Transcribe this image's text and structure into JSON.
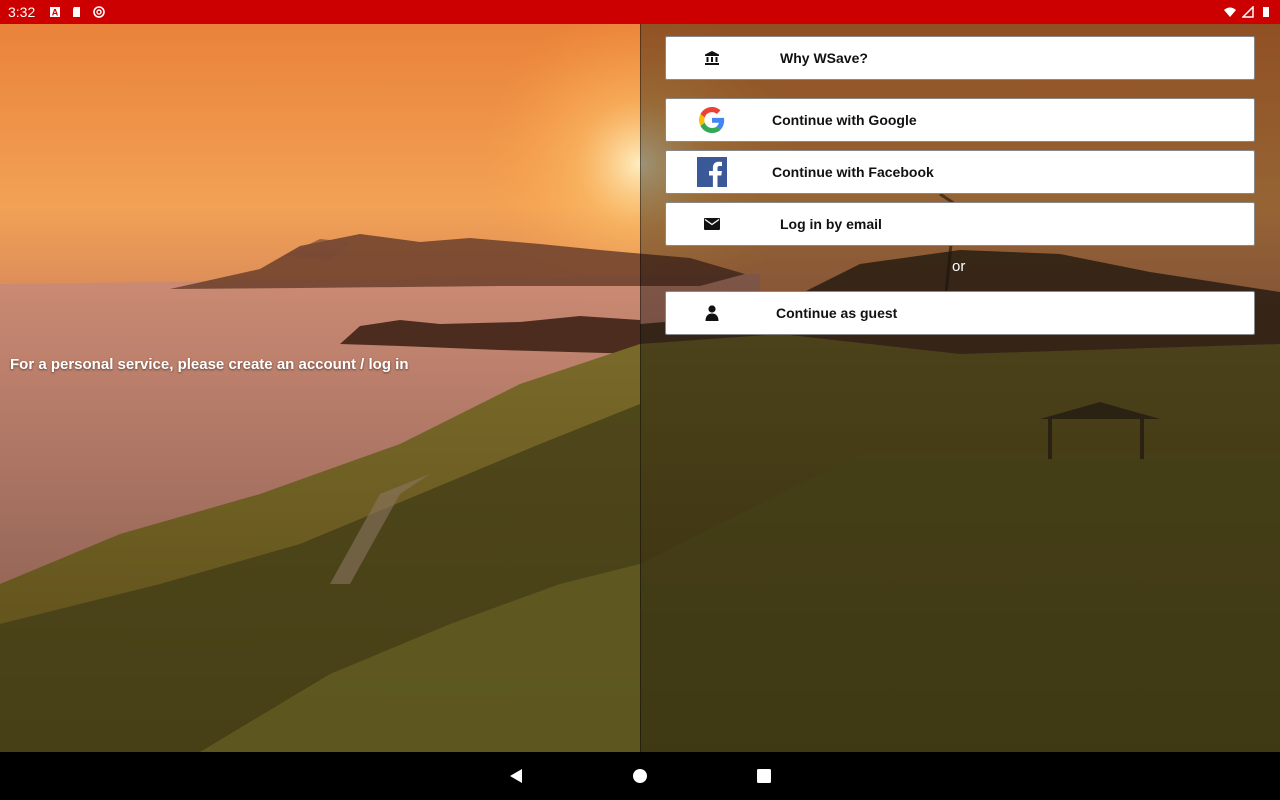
{
  "status_bar": {
    "time": "3:32",
    "background_color": "#cc0000",
    "left_icons": [
      "notification-a-icon",
      "sd-card-icon",
      "sync-icon"
    ],
    "right_icons": [
      "wifi-icon",
      "signal-icon",
      "battery-icon"
    ]
  },
  "main": {
    "tagline": "For a personal service, please create an account / log in",
    "buttons": {
      "why": {
        "label": "Why WSave?",
        "icon": "bank-icon"
      },
      "google": {
        "label": "Continue with Google",
        "icon": "google-logo-icon"
      },
      "facebook": {
        "label": "Continue with Facebook",
        "icon": "facebook-logo-icon"
      },
      "email": {
        "label": "Log in by email",
        "icon": "envelope-icon"
      },
      "guest": {
        "label": "Continue as guest",
        "icon": "person-icon"
      }
    },
    "separator": "or"
  },
  "nav_bar": {
    "buttons": [
      "back-icon",
      "home-icon",
      "recents-icon"
    ]
  }
}
